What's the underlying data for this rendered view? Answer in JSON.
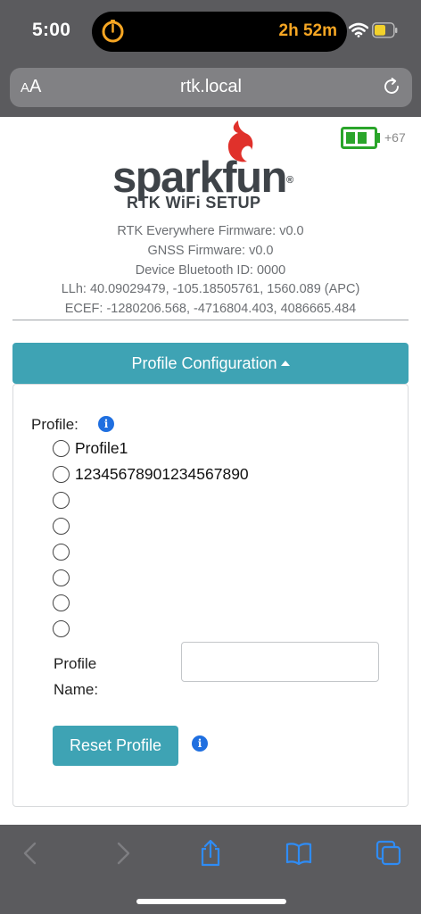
{
  "status_bar": {
    "time": "5:00",
    "timer": "2h 52m"
  },
  "browser": {
    "aa_small": "A",
    "aa_large": "A",
    "url": "rtk.local"
  },
  "device": {
    "battery_percent": "+67",
    "battery_level": 0.67
  },
  "logo": {
    "word": "sparkfun",
    "registered": "®",
    "subtitle": "RTK WiFi SETUP"
  },
  "info": {
    "firmware": "RTK Everywhere Firmware: v0.0",
    "gnss_firmware": "GNSS Firmware: v0.0",
    "bluetooth_id": "Device Bluetooth ID: 0000",
    "llh": "LLh: 40.09029479, -105.18505761, 1560.089 (APC)",
    "ecef": "ECEF: -1280206.568, -4716804.403, 4086665.484"
  },
  "section": {
    "title": "Profile Configuration"
  },
  "profile": {
    "label": "Profile:",
    "info_glyph": "i",
    "options": [
      "Profile1",
      "12345678901234567890",
      "",
      "",
      "",
      "",
      "",
      ""
    ],
    "name_label_line1": "Profile",
    "name_label_line2": "Name:",
    "name_value": "",
    "reset_label": "Reset Profile"
  },
  "colors": {
    "accent": "#3ea3b4",
    "info_blue": "#1f6fe0",
    "battery_green": "#2aa52a",
    "chrome_gray": "#5b5b5e",
    "timer_orange": "#f6a623",
    "logo_red": "#e0312b"
  },
  "icons": {
    "timer": "timer-ring-icon",
    "wifi": "wifi-icon",
    "battery": "battery-icon",
    "reload": "reload-icon",
    "back": "chevron-left-icon",
    "forward": "chevron-right-icon",
    "share": "share-icon",
    "bookmarks": "book-icon",
    "tabs": "tabs-icon"
  }
}
